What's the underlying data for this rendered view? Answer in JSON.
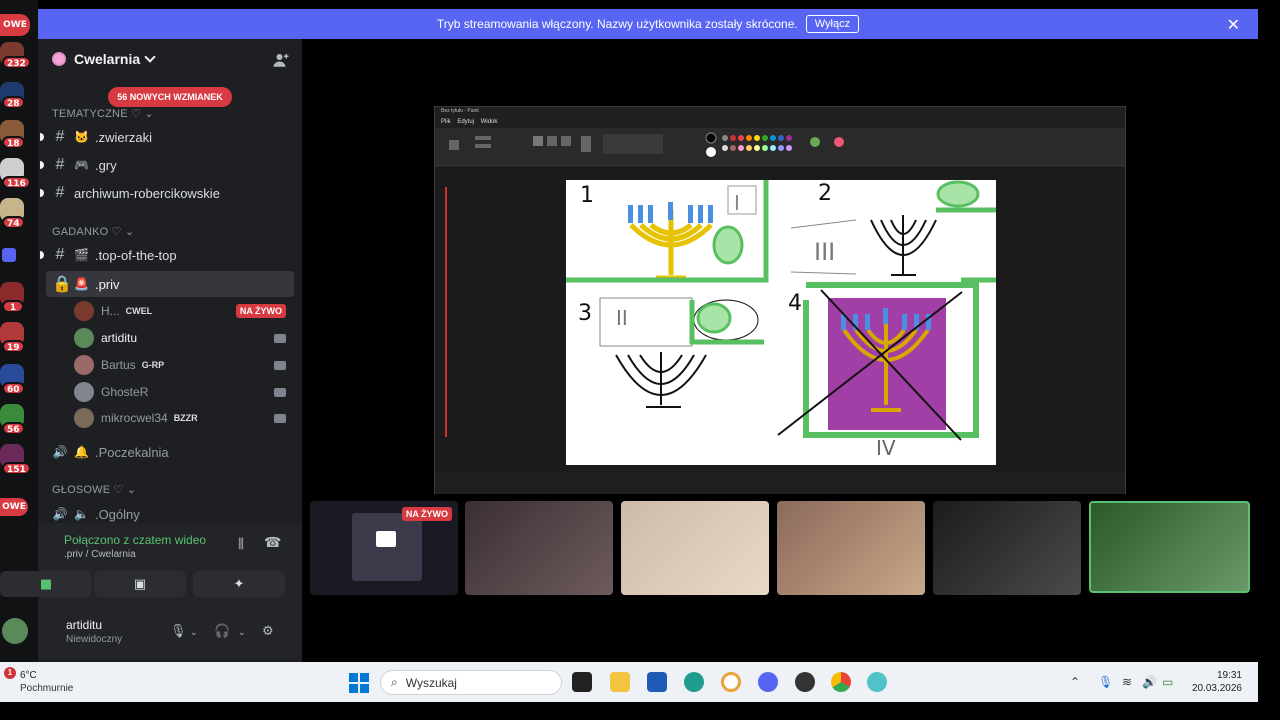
{
  "banner": {
    "text": "Tryb streamowania włączony. Nazwy użytkownika zostały skrócone.",
    "button": "Wyłącz"
  },
  "rail": {
    "top_badge": "OWE",
    "bottom_badge": "OWE",
    "badges": [
      "232",
      "28",
      "18",
      "116",
      "74",
      "1",
      "19",
      "60",
      "56",
      "151"
    ]
  },
  "server": {
    "name": "Cwelarnia",
    "mentions": "56 NOWYCH WZMIANEK"
  },
  "categories": {
    "tematyczne": "TEMATYCZNE ♡",
    "gadanko": "GADANKO ♡",
    "glosowe": "GŁOSOWE ♡"
  },
  "channels": {
    "zwierzaki": ".zwierzaki",
    "gry": ".gry",
    "archiwum": "archiwum-robercikowskie",
    "top": ".top-of-the-top",
    "priv": ".priv",
    "poczekalnia": ".Poczekalnia",
    "ogolny": ".Ogólny"
  },
  "members": [
    {
      "name": "H...",
      "tag": "CWEL",
      "live": "NA ŻYWO"
    },
    {
      "name": "artiditu",
      "tag": ""
    },
    {
      "name": "Bartus",
      "tag": "G-RP"
    },
    {
      "name": "GhosteR",
      "tag": ""
    },
    {
      "name": "mikrocwel34",
      "tag": "BZZR"
    }
  ],
  "voice": {
    "status": "Połączono z czatem wideo",
    "where": ".priv / Cwelarnia"
  },
  "user": {
    "name": "artiditu",
    "status": "Niewidoczny"
  },
  "tiles": {
    "live_label": "NA ŻYWO"
  },
  "paint": {
    "title": "Bez tytułu - Paint",
    "menu": [
      "Plik",
      "Edytuj",
      "Widok"
    ],
    "labels": [
      "1",
      "2",
      "3",
      "4",
      "I",
      "II",
      "III",
      "IV"
    ]
  },
  "taskbar": {
    "temp": "6°C",
    "weather": "Pochmurnie",
    "weather_badge": "1",
    "search": "Wyszukaj",
    "time": "19:31",
    "date": "20.03.2026"
  },
  "colors": {
    "blurple": "#5865f2",
    "danger": "#d83a42",
    "online": "#57c26f"
  }
}
